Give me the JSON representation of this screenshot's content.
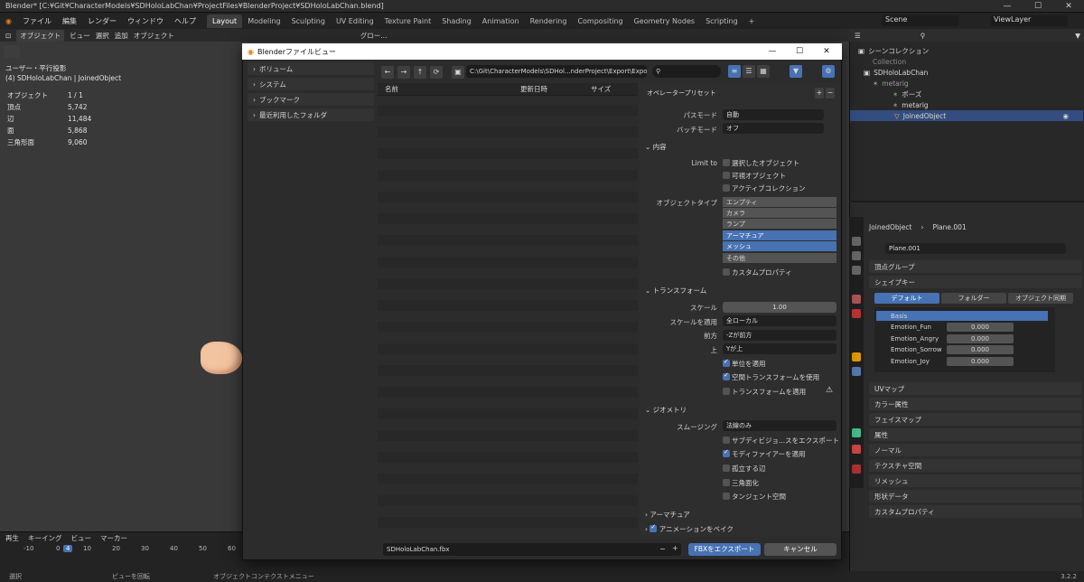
{
  "titlebar": {
    "title": "Blender* [C:¥Git¥CharacterModels¥SDHoloLabChan¥ProjectFiles¥BlenderProject¥SDHoloLabChan.blend]",
    "min": "—",
    "max": "☐",
    "close": "✕"
  },
  "menubar": {
    "menus": [
      "ファイル",
      "編集",
      "レンダー",
      "ウィンドウ",
      "ヘルプ"
    ],
    "workspaces": [
      "Layout",
      "Modeling",
      "Sculpting",
      "UV Editing",
      "Texture Paint",
      "Shading",
      "Animation",
      "Rendering",
      "Compositing",
      "Geometry Nodes",
      "Scripting"
    ],
    "add": "+",
    "scene": "Scene",
    "viewlayer": "ViewLayer"
  },
  "viewport": {
    "header": [
      "オブジェクト",
      "ビュー",
      "選択",
      "追加",
      "オブジェクト",
      "グロー..."
    ],
    "view_name": "ユーザー・平行投影",
    "object_line": "(4) SDHoloLabChan | JoinedObject",
    "stats": [
      {
        "k": "オブジェクト",
        "v": "1 / 1"
      },
      {
        "k": "頂点",
        "v": "5,742"
      },
      {
        "k": "辺",
        "v": "11,484"
      },
      {
        "k": "面",
        "v": "5,868"
      },
      {
        "k": "三角形面",
        "v": "9,060"
      }
    ]
  },
  "timeline": {
    "menus": [
      "再生",
      "キーイング",
      "ビュー",
      "マーカー"
    ],
    "ticks": [
      "-10",
      "0",
      "4",
      "10",
      "20",
      "30",
      "40",
      "50",
      "60"
    ]
  },
  "statusbar": {
    "items": [
      "選択",
      "ビューを回転",
      "オブジェクトコンテクストメニュー"
    ],
    "version": "3.2.2"
  },
  "outliner": {
    "header": "シーンコレクション",
    "rows": [
      "Collection",
      "SDHoloLabChan",
      "metarig",
      "ポーズ",
      "metarig",
      "JoinedObject"
    ]
  },
  "properties": {
    "breadcrumb": [
      "JoinedObject",
      "Plane.001"
    ],
    "mesh_name": "Plane.001",
    "panels": [
      "頂点グループ",
      "シェイプキー",
      "UVマップ",
      "カラー属性",
      "フェイスマップ",
      "属性",
      "ノーマル",
      "テクスチャ空間",
      "リメッシュ",
      "形状データ",
      "カスタムプロパティ"
    ],
    "shapekey_tabs": [
      "デフォルト",
      "フォルダー",
      "オブジェクト同期"
    ],
    "shapekeys": [
      {
        "name": "Basis",
        "value": ""
      },
      {
        "name": "Emotion_Fun",
        "value": "0.000"
      },
      {
        "name": "Emotion_Angry",
        "value": "0.000"
      },
      {
        "name": "Emotion_Sorrow",
        "value": "0.000"
      },
      {
        "name": "Emotion_Joy",
        "value": "0.000"
      }
    ]
  },
  "dialog": {
    "title": "Blenderファイルビュー",
    "sidebar": [
      "ボリューム",
      "システム",
      "ブックマーク",
      "最近利用したフォルダ"
    ],
    "path": "C:\\Git\\CharacterModels\\SDHol...nderProject\\Export\\ExportTest\\",
    "search_placeholder": "",
    "columns": [
      "名前",
      "更新日時",
      "サイズ"
    ],
    "operator_presets": "オペレータープリセット",
    "path_mode_label": "パスモード",
    "path_mode": "自動",
    "batch_mode_label": "バッチモード",
    "batch_mode": "オフ",
    "include_section": "内容",
    "limit_to": "Limit to",
    "limit_options": [
      "選択したオブジェクト",
      "可視オブジェクト",
      "アクティブコレクション"
    ],
    "object_types_label": "オブジェクトタイプ",
    "object_types": [
      {
        "name": "エンプティ",
        "on": false
      },
      {
        "name": "カメラ",
        "on": false
      },
      {
        "name": "ランプ",
        "on": false
      },
      {
        "name": "アーマチュア",
        "on": true
      },
      {
        "name": "メッシュ",
        "on": true
      },
      {
        "name": "その他",
        "on": false
      }
    ],
    "custom_props": "カスタムプロパティ",
    "transform_section": "トランスフォーム",
    "scale_label": "スケール",
    "scale": "1.00",
    "apply_scale_label": "スケールを適用",
    "apply_scale": "全ローカル",
    "forward_label": "前方",
    "forward": "-Zが前方",
    "up_label": "上",
    "up": "Yが上",
    "apply_unit": "単位を適用",
    "use_space_transform": "空間トランスフォームを使用",
    "apply_transform": "トランスフォームを適用",
    "geometry_section": "ジオメトリ",
    "smoothing_label": "スムージング",
    "smoothing": "法線のみ",
    "geo_options": [
      {
        "name": "サブディビジョ...スをエクスポート",
        "on": false
      },
      {
        "name": "モディファイアーを適用",
        "on": true
      },
      {
        "name": "孤立する辺",
        "on": false
      },
      {
        "name": "三角面化",
        "on": false
      },
      {
        "name": "タンジェント空間",
        "on": false
      }
    ],
    "armature_section": "アーマチュア",
    "bake_anim": "アニメーションをベイク",
    "filename": "SDHoloLabChan.fbx",
    "export_button": "FBXをエクスポート",
    "cancel_button": "キャンセル"
  }
}
